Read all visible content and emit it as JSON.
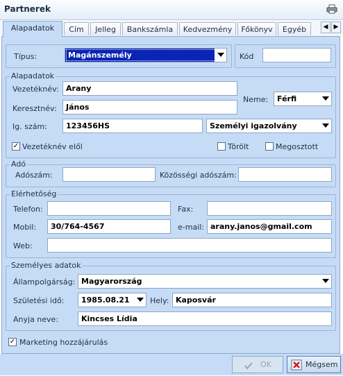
{
  "window": {
    "title": "Partnerek"
  },
  "tabs": [
    "Alapadatok",
    "Cím",
    "Jelleg",
    "Bankszámla",
    "Kedvezmény",
    "Főkönyv",
    "Egyéb"
  ],
  "type_row": {
    "tipus_label": "Típus:",
    "tipus_value": "Magánszemély",
    "kod_label": "Kód",
    "kod_value": ""
  },
  "alapadatok": {
    "legend": "Alapadatok",
    "vezeteknev_label": "Vezetéknév:",
    "vezeteknev": "Arany",
    "keresztnev_label": "Keresztnév:",
    "keresztnev": "János",
    "neme_label": "Neme:",
    "neme": "Férfi",
    "igszam_label": "Ig. szám:",
    "igszam": "123456HS",
    "igtipus": "Személyi igazolvány",
    "vezeteknev_elol": "Vezetéknév elől",
    "torolt": "Törölt",
    "megosztott": "Megosztott"
  },
  "ado": {
    "legend": "Adó",
    "adoszam_label": "Adószám:",
    "adoszam": "",
    "kozossegi_label": "Közösségi adószám:",
    "kozossegi": ""
  },
  "elerhetoseg": {
    "legend": "Elérhetőség",
    "telefon_label": "Telefon:",
    "telefon": "",
    "fax_label": "Fax:",
    "fax": "",
    "mobil_label": "Mobil:",
    "mobil": "30/764-4567",
    "email_label": "e-mail:",
    "email": "arany.janos@gmail.com",
    "web_label": "Web:",
    "web": ""
  },
  "szemelyes": {
    "legend": "Személyes adatok",
    "allampolgarsag_label": "Állampolgárság:",
    "allampolgarsag": "Magyarország",
    "szuletesi_ido_label": "Születési idő:",
    "szuletesi_ido": "1985.08.21",
    "hely_label": "Hely:",
    "hely": "Kaposvár",
    "anyja_label": "Anyja neve:",
    "anyja": "Kincses Lídia"
  },
  "marketing": "Marketing hozzájárulás",
  "buttons": {
    "ok": "OK",
    "cancel": "Mégsem"
  },
  "colors": {
    "panel": "#c6dcf6",
    "selection": "#0a24b4"
  }
}
